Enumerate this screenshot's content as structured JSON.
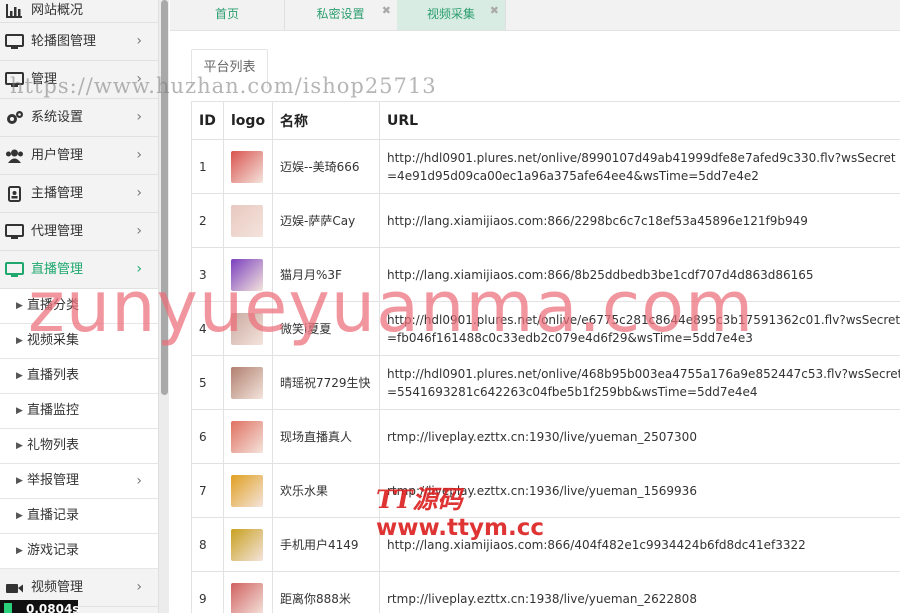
{
  "sidebar": {
    "items": [
      {
        "label": "网站概况",
        "icon": "bar-chart-icon",
        "chevron": false
      },
      {
        "label": "轮播图管理",
        "icon": "monitor-icon",
        "chevron": true
      },
      {
        "label": "管理",
        "icon": "monitor-icon",
        "chevron": true
      },
      {
        "label": "系统设置",
        "icon": "gears-icon",
        "chevron": true
      },
      {
        "label": "用户管理",
        "icon": "users-icon",
        "chevron": true
      },
      {
        "label": "主播管理",
        "icon": "id-badge-icon",
        "chevron": true
      },
      {
        "label": "代理管理",
        "icon": "monitor-icon",
        "chevron": true
      },
      {
        "label": "直播管理",
        "icon": "monitor-icon",
        "chevron": true,
        "active": true
      }
    ],
    "sub_items": [
      {
        "label": "直播分类"
      },
      {
        "label": "视频采集"
      },
      {
        "label": "直播列表"
      },
      {
        "label": "直播监控"
      },
      {
        "label": "礼物列表"
      },
      {
        "label": "举报管理",
        "chevron": true
      },
      {
        "label": "直播记录"
      },
      {
        "label": "游戏记录"
      }
    ],
    "bottom_item": {
      "label": "视频管理",
      "icon": "video-camera-icon"
    },
    "corner_badge": "0.0804s"
  },
  "tabs": [
    {
      "label": "首页",
      "closable": false
    },
    {
      "label": "私密设置",
      "closable": true
    },
    {
      "label": "视频采集",
      "closable": true,
      "active": true
    }
  ],
  "main": {
    "subtab_label": "平台列表",
    "table": {
      "headers": [
        "ID",
        "logo",
        "名称",
        "URL"
      ],
      "rows": [
        {
          "id": "1",
          "name": "迈娱--美琦666",
          "url": "http://hdl0901.plures.net/onlive/8990107d49ab41999dfe8e7afed9c330.flv?wsSecret=4e91d95d09ca00ec1a96a375afe64ee4&wsTime=5dd7e4e2",
          "logo_color": "#d9534f"
        },
        {
          "id": "2",
          "name": "迈娱-萨萨Cay",
          "url": "http://lang.xiamijiaos.com:866/2298bc6c7c18ef53a45896e121f9b949",
          "logo_color": "#e8c8c0"
        },
        {
          "id": "3",
          "name": "猫月月%3F",
          "url": "http://lang.xiamijiaos.com:866/8b25ddbedb3be1cdf707d4d863d86165",
          "logo_color": "#7b3fbf"
        },
        {
          "id": "4",
          "name": "微笑i夏夏",
          "url": "http://hdl0901.plures.net/onlive/e6775c281c8644e895c3b17591362c01.flv?wsSecret=fb046f161488c0c33edb2c079e4d6f29&wsTime=5dd7e4e3",
          "logo_color": "#c9a9a0"
        },
        {
          "id": "5",
          "name": "晴瑶祝7729生快",
          "url": "http://hdl0901.plures.net/onlive/468b95b003ea4755a176a9e852447c53.flv?wsSecret=5541693281c642263c04fbe5b1f259bb&wsTime=5dd7e4e4",
          "logo_color": "#b08070"
        },
        {
          "id": "6",
          "name": "现场直播真人",
          "url": "rtmp://liveplay.ezttx.cn:1930/live/yueman_2507300",
          "logo_color": "#e07060"
        },
        {
          "id": "7",
          "name": "欢乐水果",
          "url": "rtmp://liveplay.ezttx.cn:1936/live/yueman_1569936",
          "logo_color": "#e0a020"
        },
        {
          "id": "8",
          "name": "手机用户4149",
          "url": "http://lang.xiamijiaos.com:866/404f482e1c9934424b6fd8dc41ef3322",
          "logo_color": "#c8a020"
        },
        {
          "id": "9",
          "name": "距离你888米",
          "url": "rtmp://liveplay.ezttx.cn:1938/live/yueman_2622808",
          "logo_color": "#d06060"
        }
      ]
    }
  },
  "watermarks": {
    "top": "https://www.huzhan.com/ishop25713",
    "center": "zunyueyuanma.com",
    "bottom_logo": "TT源码",
    "bottom_url": "www.ttym.cc"
  },
  "colors": {
    "accent": "#1ea86e",
    "tab_text": "#2c9e6f",
    "watermark_pink": "#ec6e78",
    "watermark_red": "#dc1e1e"
  }
}
